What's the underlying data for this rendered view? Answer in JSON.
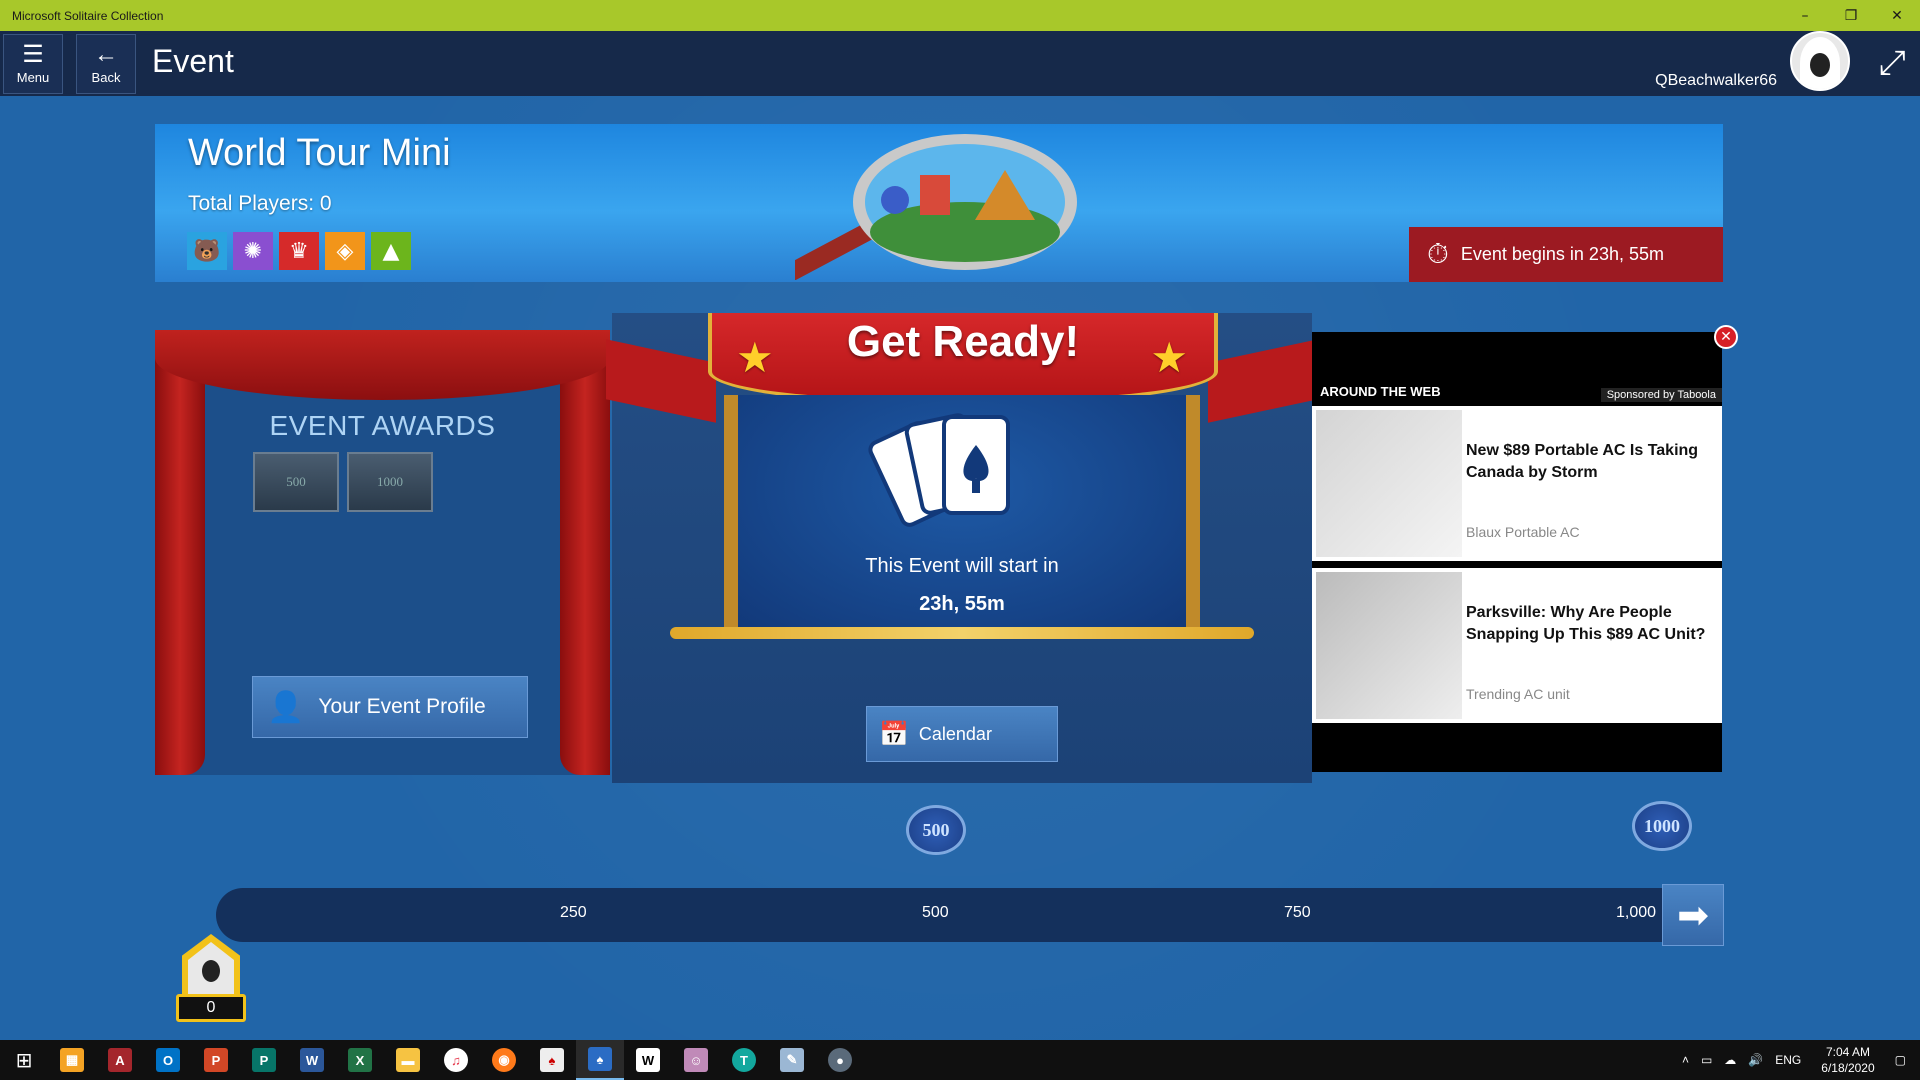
{
  "window": {
    "title": "Microsoft Solitaire Collection",
    "minimize": "–",
    "restore": "❐",
    "close": "✕"
  },
  "header": {
    "menu_label": "Menu",
    "back_label": "Back",
    "page_title": "Event",
    "username": "QBeachwalker66"
  },
  "banner": {
    "title": "World Tour Mini",
    "total_players": "Total Players: 0",
    "event_begins": "Event begins in 23h, 55m",
    "mode_icons": [
      {
        "name": "bear-icon",
        "color": "#2aa3e0",
        "glyph": "🐻"
      },
      {
        "name": "spider-icon",
        "color": "#8a4fd0",
        "glyph": "✺"
      },
      {
        "name": "crown-icon",
        "color": "#d62a2a",
        "glyph": "♛"
      },
      {
        "name": "diamond-icon",
        "color": "#f2951a",
        "glyph": "◈"
      },
      {
        "name": "pyramid-icon",
        "color": "#6cb51c",
        "glyph": "▲"
      }
    ]
  },
  "awards": {
    "title": "EVENT AWARDS",
    "badges": [
      "500",
      "1000"
    ],
    "profile_button": "Your Event Profile"
  },
  "ready": {
    "title": "Get Ready!",
    "message": "This Event will start in",
    "time": "23h, 55m",
    "calendar_button": "Calendar"
  },
  "ad": {
    "header": "AROUND THE WEB",
    "sponsor": "Sponsored by Taboola",
    "items": [
      {
        "title": "New $89 Portable AC Is Taking Canada by Storm",
        "source": "Blaux Portable AC"
      },
      {
        "title": "Parksville: Why Are People Snapping Up This $89 AC Unit?",
        "source": "Trending AC unit"
      }
    ]
  },
  "progress": {
    "ticks": [
      "250",
      "500",
      "750",
      "1,000"
    ],
    "milestone_medals": [
      "500",
      "1000"
    ],
    "player_score": "0"
  },
  "taskbar": {
    "time": "7:04 AM",
    "date": "6/18/2020",
    "lang": "ENG"
  },
  "colors": {
    "titlebar": "#a8c82a",
    "header": "#16294a",
    "background": "#2165a8",
    "event_red": "#9c1a22",
    "button_blue": "#3f78b8"
  }
}
